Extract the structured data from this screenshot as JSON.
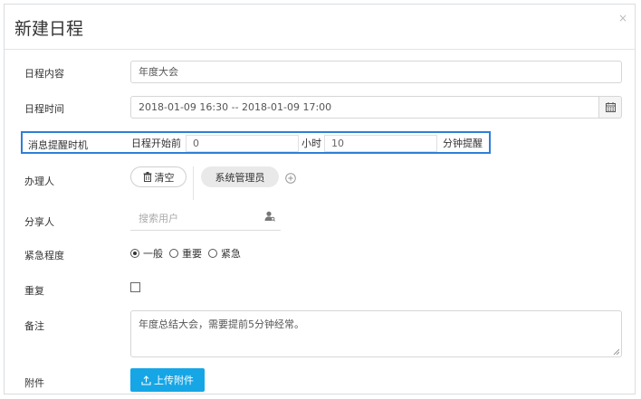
{
  "dialog": {
    "title": "新建日程",
    "close_symbol": "×"
  },
  "form": {
    "content": {
      "label": "日程内容",
      "value": "年度大会"
    },
    "time": {
      "label": "日程时间",
      "value": "2018-01-09 16:30 -- 2018-01-09 17:00"
    },
    "reminder": {
      "label": "消息提醒时机",
      "prefix": "日程开始前",
      "hours_value": "0",
      "hours_unit": "小时",
      "minutes_value": "10",
      "suffix": "分钟提醒"
    },
    "assignee": {
      "label": "办理人",
      "clear_label": "清空",
      "person": "系统管理员"
    },
    "share": {
      "label": "分享人",
      "placeholder": "搜索用户"
    },
    "urgency": {
      "label": "紧急程度",
      "options": [
        "一般",
        "重要",
        "紧急"
      ],
      "selected": "一般"
    },
    "repeat": {
      "label": "重复"
    },
    "note": {
      "label": "备注",
      "value": "年度总结大会，需要提前5分钟经常。"
    },
    "attachment": {
      "label": "附件",
      "button_label": "上传附件"
    }
  },
  "colors": {
    "highlight": "#2e7fd6",
    "upload_button": "#16a6e6"
  }
}
